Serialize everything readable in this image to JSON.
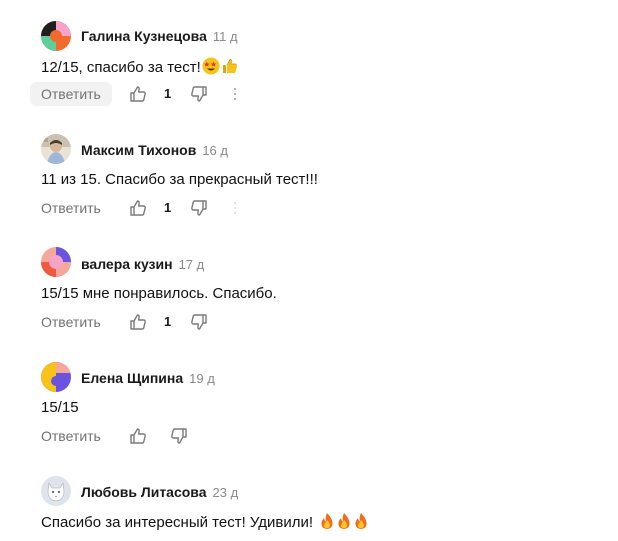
{
  "comments": [
    {
      "author": "Галина Кузнецова",
      "age": "11 д",
      "text": "12/15, спасибо за тест!",
      "emojis": [
        "star-struck",
        "thumbs-up"
      ],
      "reply_label": "Ответить",
      "likes": "1"
    },
    {
      "author": "Максим Тихонов",
      "age": "16 д",
      "text": "11 из 15. Спасибо за прекрасный тест!!!",
      "reply_label": "Ответить",
      "likes": "1"
    },
    {
      "author": "валера кузин",
      "age": "17 д",
      "text": "15/15 мне понравилось. Спасибо.",
      "reply_label": "Ответить",
      "likes": "1"
    },
    {
      "author": "Елена Щипина",
      "age": "19 д",
      "text": "15/15",
      "reply_label": "Ответить",
      "likes": ""
    },
    {
      "author": "Любовь Литасова",
      "age": "23 д",
      "text": "Спасибо за интересный тест! Удивили!",
      "emojis": [
        "fire",
        "fire",
        "fire"
      ]
    }
  ],
  "icons": {
    "like": "thumbs-up-outline-icon",
    "dislike": "thumbs-down-outline-icon",
    "more": "vertical-ellipsis-icon"
  }
}
